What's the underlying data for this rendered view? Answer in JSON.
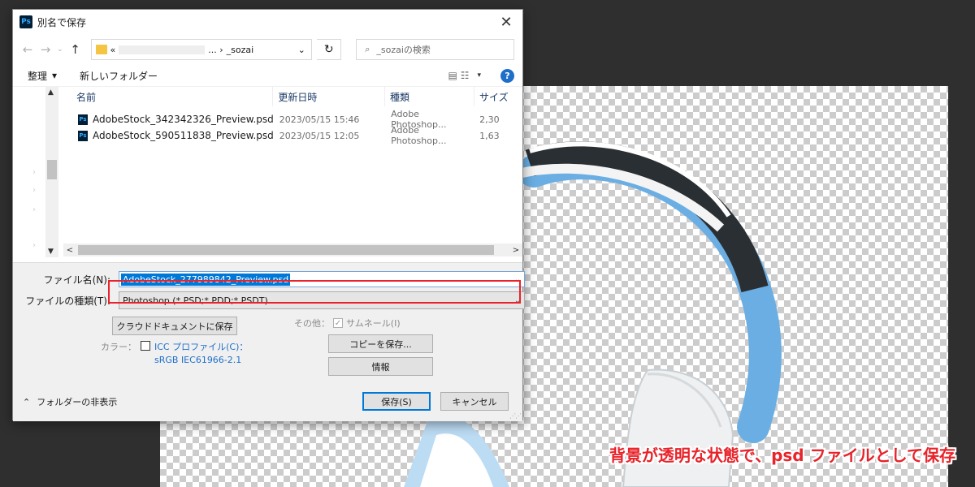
{
  "dialog": {
    "title": "別名で保存",
    "app_icon_text": "Ps",
    "close_glyph": "✕"
  },
  "navigation": {
    "back_glyph": "←",
    "forward_glyph": "→",
    "recent_glyph": "⌄",
    "up_glyph": "↑",
    "address_prefix": "«",
    "address_sep": "... ›",
    "address_current": "_sozai",
    "address_chevron": "⌄",
    "refresh_glyph": "↻",
    "search_icon": "⌕",
    "search_placeholder": "_sozaiの検索"
  },
  "toolbar": {
    "organize_label": "整理",
    "organize_arrow": "▾",
    "new_folder_label": "新しいフォルダー",
    "view_icon": "▤ ☷",
    "view_arrow": "▾",
    "help_label": "?"
  },
  "columns": {
    "sort_glyph": "^",
    "name": "名前",
    "date": "更新日時",
    "type": "種類",
    "size": "サイズ"
  },
  "files": [
    {
      "icon": "Ps",
      "name": "AdobeStock_342342326_Preview.psd",
      "date": "2023/05/15 15:46",
      "type": "Adobe Photoshop...",
      "size": "2,30"
    },
    {
      "icon": "Ps",
      "name": "AdobeStock_590511838_Preview.psd",
      "date": "2023/05/15 12:05",
      "type": "Adobe Photoshop...",
      "size": "1,63"
    }
  ],
  "scroll": {
    "up": "▲",
    "down": "▼",
    "left": "<",
    "right": ">"
  },
  "form": {
    "filename_label": "ファイル名(N):",
    "filename_value": "AdobeStock_277989842_Preview.psd",
    "filetype_label": "ファイルの種類(T):",
    "filetype_value": "Photoshop (*.PSD;*.PDD;*.PSDT)",
    "chevron": "⌄",
    "cloud_save_button": "クラウドドキュメントに保存",
    "other_label": "その他：",
    "thumbnail_label": "サムネール(I)",
    "color_label": "カラー：",
    "icc_profile_label": "ICC プロファイル(C)：",
    "icc_profile_value": "sRGB IEC61966-2.1",
    "save_copy_button": "コピーを保存...",
    "info_button": "情報",
    "hide_folders_label": "フォルダーの非表示",
    "hide_folders_glyph": "⌃",
    "save_button": "保存(S)",
    "cancel_button": "キャンセル",
    "check_glyph": "✓"
  },
  "annotation": {
    "caption": "背景が透明な状態で、psd ファイルとして保存",
    "highlight_color": "#e8232a"
  }
}
